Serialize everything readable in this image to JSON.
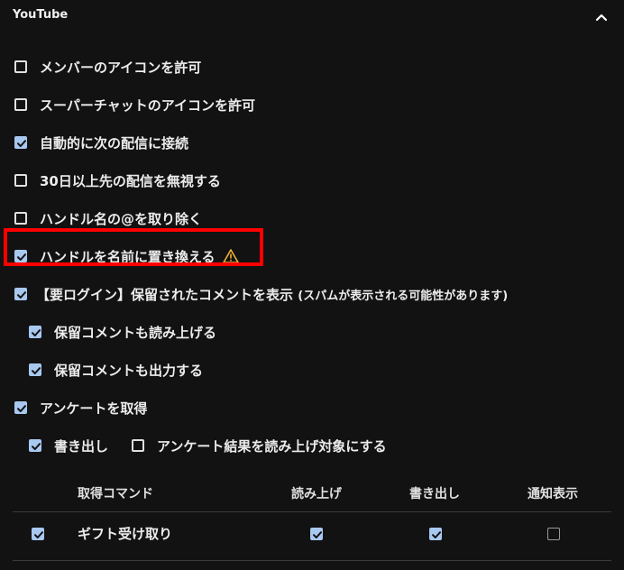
{
  "section": {
    "title": "YouTube"
  },
  "options": [
    {
      "label": "メンバーのアイコンを許可",
      "checked": false
    },
    {
      "label": "スーパーチャットのアイコンを許可",
      "checked": false
    },
    {
      "label": "自動的に次の配信に接続",
      "checked": true
    },
    {
      "label": "30日以上先の配信を無視する",
      "checked": false
    },
    {
      "label": "ハンドル名の@を取り除く",
      "checked": false
    },
    {
      "label": "ハンドルを名前に置き換える",
      "checked": true,
      "warning_icon": "warning-triangle-icon"
    },
    {
      "label": "【要ログイン】保留されたコメントを表示",
      "note": "(スパムが表示される可能性があります)",
      "checked": true
    },
    {
      "label": "保留コメントも読み上げる",
      "checked": true
    },
    {
      "label": "保留コメントも出力する",
      "checked": true
    },
    {
      "label": "アンケートを取得",
      "checked": true
    }
  ],
  "survey_options": [
    {
      "label": "書き出し",
      "checked": true
    },
    {
      "label": "アンケート結果を読み上げ対象にする",
      "checked": false
    }
  ],
  "command_table": {
    "headers": [
      "取得コマンド",
      "読み上げ",
      "書き出し",
      "通知表示"
    ],
    "rows": [
      {
        "enabled": true,
        "name": "ギフト受け取り",
        "read": true,
        "write": true,
        "notify": false
      }
    ]
  },
  "colors": {
    "background": "#121212",
    "checkbox_checked": "#a8c8f0",
    "warning": "#f2b134",
    "highlight": "#ff0000"
  }
}
